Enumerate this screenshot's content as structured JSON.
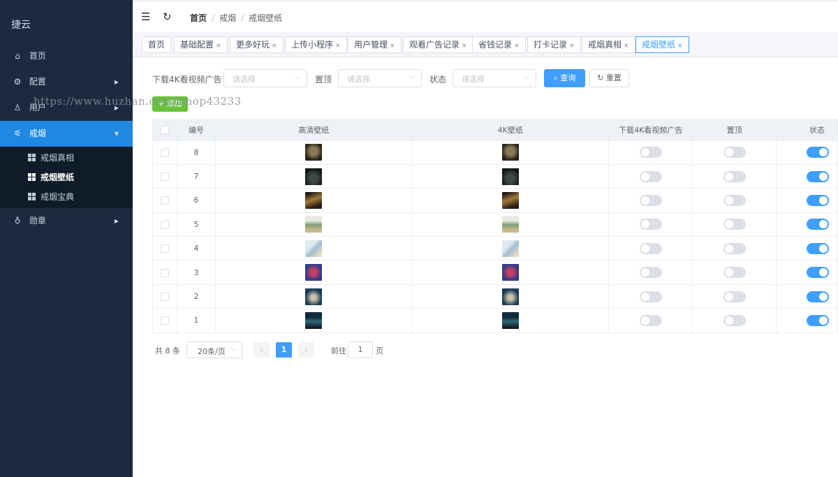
{
  "sidebar": {
    "logo": "捷云",
    "items": [
      {
        "label": "首页",
        "icon": "home-icon"
      },
      {
        "label": "配置",
        "icon": "gear-icon"
      },
      {
        "label": "用户",
        "icon": "user-icon"
      },
      {
        "label": "戒烟",
        "icon": "smoke-icon"
      },
      {
        "label": "勋章",
        "icon": "medal-icon"
      }
    ],
    "submenu": [
      {
        "label": "戒烟真相"
      },
      {
        "label": "戒烟壁纸"
      },
      {
        "label": "戒烟宝典"
      }
    ]
  },
  "header": {
    "breadcrumb": [
      "首页",
      "戒烟",
      "戒烟壁纸"
    ]
  },
  "tags": [
    "首页",
    "基础配置",
    "更多好玩",
    "上传小程序",
    "用户管理",
    "观看广告记录",
    "省钱记录",
    "打卡记录",
    "戒烟真相",
    "戒烟壁纸"
  ],
  "search": {
    "field1_label": "下载4K看视频广告",
    "field2_label": "置顶",
    "field3_label": "状态",
    "placeholder": "请选择",
    "query_button": "查询",
    "reset_button": "重置"
  },
  "add_button": "+ 添加",
  "watermark": "https://www.huzhan.com/ishop43233",
  "table": {
    "columns": [
      "编号",
      "高清壁纸",
      "4K壁纸",
      "下载4K看视频广告",
      "置顶",
      "状态"
    ],
    "rows": [
      {
        "id": "8",
        "download_ad": false,
        "top": false,
        "status": true
      },
      {
        "id": "7",
        "download_ad": false,
        "top": false,
        "status": true
      },
      {
        "id": "6",
        "download_ad": false,
        "top": false,
        "status": true
      },
      {
        "id": "5",
        "download_ad": false,
        "top": false,
        "status": true
      },
      {
        "id": "4",
        "download_ad": false,
        "top": false,
        "status": true
      },
      {
        "id": "3",
        "download_ad": false,
        "top": false,
        "status": true
      },
      {
        "id": "2",
        "download_ad": false,
        "top": false,
        "status": true
      },
      {
        "id": "1",
        "download_ad": false,
        "top": false,
        "status": true
      }
    ]
  },
  "pagination": {
    "total": "共 8 条",
    "page_size": "20条/页",
    "current": "1",
    "goto_label": "前往",
    "goto_value": "1",
    "page_suffix": "页"
  },
  "colors": {
    "sidebar_bg": "#1b2a3f",
    "active_menu": "#1f88e5",
    "primary": "#409eff",
    "success": "#67c23a"
  }
}
